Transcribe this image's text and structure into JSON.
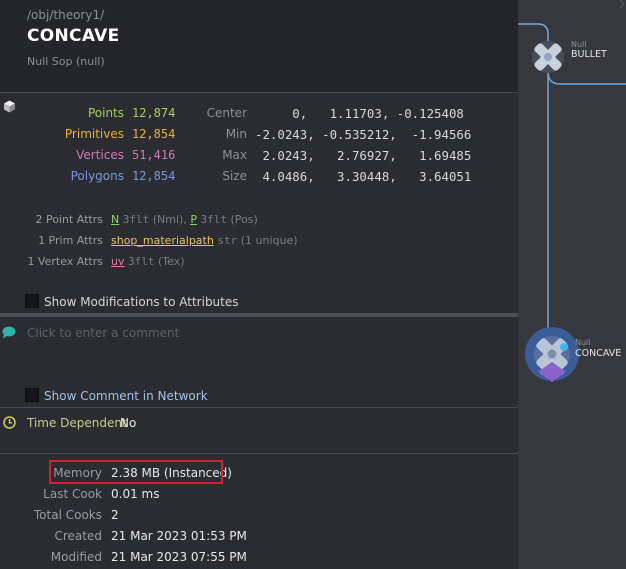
{
  "header": {
    "path": "/obj/theory1/",
    "title": "CONCAVE",
    "subtitle": "Null Sop (null)"
  },
  "geometry": {
    "icon": "geometry-cube-icon",
    "counts": [
      {
        "label": "Points",
        "value": "12,874",
        "color": "#a6d35a"
      },
      {
        "label": "Primitives",
        "value": "12,854",
        "color": "#e8b33a"
      },
      {
        "label": "Vertices",
        "value": "51,416",
        "color": "#d178b8"
      },
      {
        "label": "Polygons",
        "value": "12,854",
        "color": "#7c97e0"
      }
    ],
    "bounds": [
      {
        "label": "Center",
        "value": "     0,   1.11703, -0.125408"
      },
      {
        "label": "Min",
        "value": "-2.0243, -0.535212,  -1.94566"
      },
      {
        "label": "Max",
        "value": " 2.0243,   2.76927,   1.69485"
      },
      {
        "label": "Size",
        "value": " 4.0486,   3.30448,   3.64051"
      }
    ]
  },
  "attributes": {
    "point_label": "2 Point Attrs",
    "point_n_name": "N",
    "point_n_type": "3flt",
    "point_n_desc": "(Nml),",
    "point_p_name": "P",
    "point_p_type": "3flt",
    "point_p_desc": "(Pos)",
    "prim_label": "1 Prim Attrs",
    "prim_name": "shop_materialpath",
    "prim_type": "str",
    "prim_desc": "(1 unique)",
    "vertex_label": "1 Vertex Attrs",
    "vertex_name": "uv",
    "vertex_type": "3flt",
    "vertex_desc": "(Tex)"
  },
  "show_modifications_label": "Show Modifications to Attributes",
  "comment": {
    "icon": "comment-bubble-icon",
    "placeholder": "Click to enter a comment",
    "show_in_network_label": "Show Comment in Network"
  },
  "time_dependent": {
    "icon": "clock-icon",
    "label": "Time Dependent",
    "value": "No"
  },
  "info": [
    {
      "label": "Memory",
      "value": "2.38 MB (Instanced)"
    },
    {
      "label": "Last Cook",
      "value": "0.01 ms"
    },
    {
      "label": "Total Cooks",
      "value": "2"
    },
    {
      "label": "Created",
      "value": "21 Mar 2023 01:53 PM"
    },
    {
      "label": "Modified",
      "value": "21 Mar 2023 07:55 PM"
    }
  ],
  "network": {
    "nodes": [
      {
        "type": "Null",
        "name": "BULLET"
      },
      {
        "type": "Null",
        "name": "CONCAVE"
      }
    ],
    "wire_color": "#6fa8e0",
    "selected_color": "#6d8ccc"
  }
}
